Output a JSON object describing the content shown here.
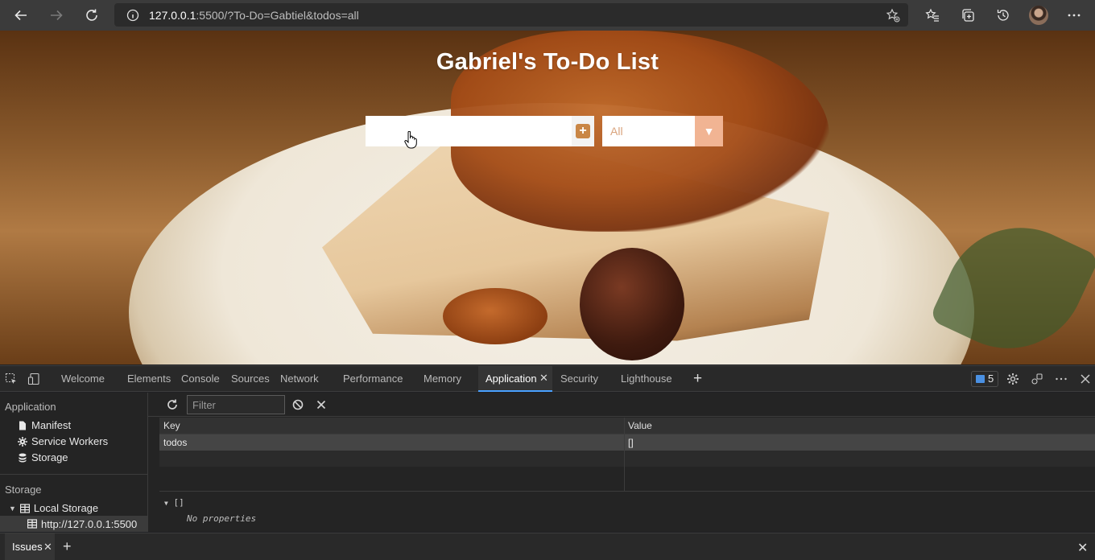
{
  "browser": {
    "url_host": "127.0.0.1",
    "url_rest": ":5500/?To-Do=Gabtiel&todos=all"
  },
  "page": {
    "title": "Gabriel's To-Do List",
    "todo_input_value": "",
    "add_icon": "plus-square-icon",
    "filter_selected": "All",
    "colors": {
      "add_button": "#c98646",
      "filter_arrow_bg": "#f1b493",
      "filter_text": "#d9a37c"
    }
  },
  "devtools": {
    "tabs": [
      "Welcome",
      "Elements",
      "Console",
      "Sources",
      "Network",
      "Performance",
      "Memory",
      "Application",
      "Security",
      "Lighthouse"
    ],
    "active_tab": "Application",
    "issues_count": "5",
    "sidebar": {
      "application_header": "Application",
      "application_items": [
        "Manifest",
        "Service Workers",
        "Storage"
      ],
      "storage_header": "Storage",
      "local_storage": "Local Storage",
      "origin": "http://127.0.0.1:5500"
    },
    "toolbar": {
      "filter_placeholder": "Filter"
    },
    "table": {
      "headers": [
        "Key",
        "Value"
      ],
      "rows": [
        {
          "key": "todos",
          "value": "[]"
        }
      ]
    },
    "preview": {
      "root": "[]",
      "empty": "No properties"
    },
    "drawer": {
      "tab": "Issues"
    },
    "accent": "#4aa1ff"
  }
}
